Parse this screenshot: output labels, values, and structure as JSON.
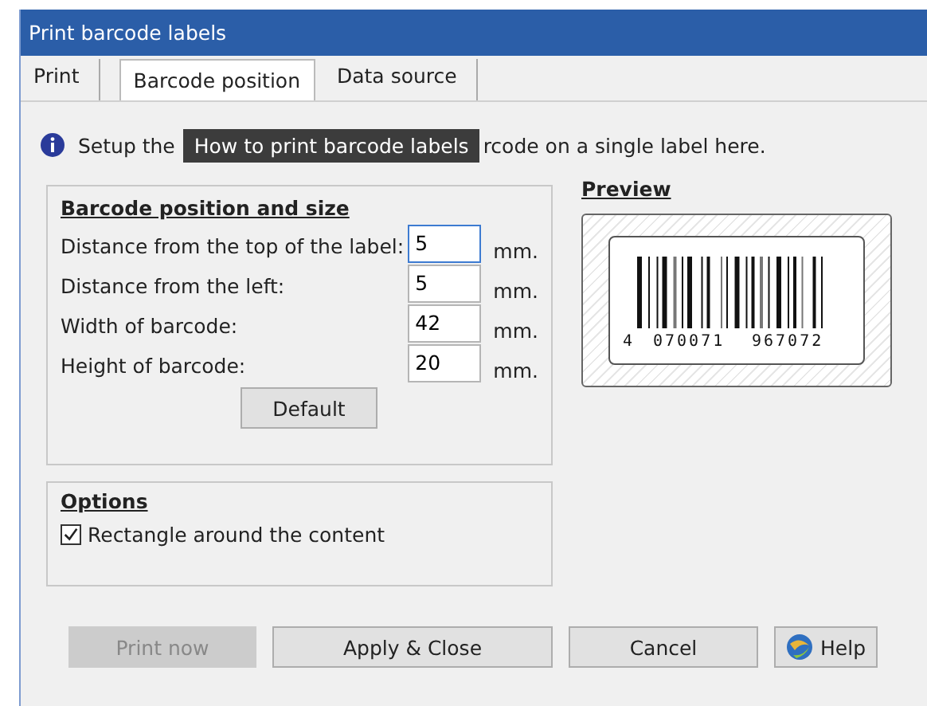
{
  "window": {
    "title": "Print barcode labels"
  },
  "tabs": [
    {
      "label": "Print",
      "selected": false
    },
    {
      "label": "Barcode position",
      "selected": true
    },
    {
      "label": "Data source",
      "selected": false
    }
  ],
  "info": {
    "before": "Setup the",
    "after": "rcode on a single label here."
  },
  "tooltip": "How to print barcode labels",
  "position_group": {
    "title": "Barcode position and size",
    "fields": [
      {
        "label": "Distance from the top of the label:",
        "value": "5",
        "unit": "mm.",
        "focused": true
      },
      {
        "label": "Distance from the left:",
        "value": "5",
        "unit": "mm.",
        "focused": false
      },
      {
        "label": "Width of barcode:",
        "value": "42",
        "unit": "mm.",
        "focused": false
      },
      {
        "label": "Height of barcode:",
        "value": "20",
        "unit": "mm.",
        "focused": false
      }
    ],
    "default_button": "Default"
  },
  "preview": {
    "title": "Preview",
    "digits": [
      "4",
      "070071",
      "967072"
    ]
  },
  "options_group": {
    "title": "Options",
    "checkboxes": [
      {
        "label": "Rectangle around the content",
        "checked": true
      }
    ]
  },
  "buttons": [
    {
      "label": "Print now",
      "disabled": true,
      "kind": "plain"
    },
    {
      "label": "Apply & Close",
      "disabled": false,
      "kind": "plain"
    },
    {
      "label": "Cancel",
      "disabled": false,
      "kind": "plain"
    },
    {
      "label": "Help",
      "disabled": false,
      "kind": "help"
    }
  ]
}
